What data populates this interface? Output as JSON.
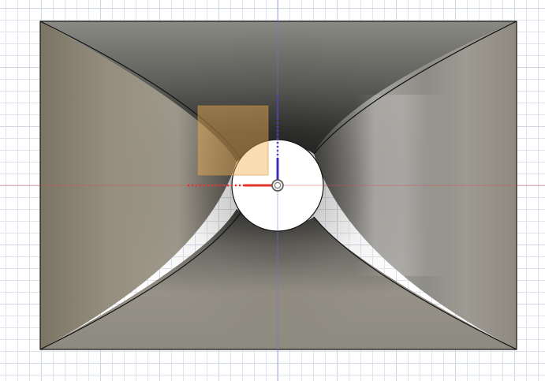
{
  "viewport": {
    "view": "top",
    "grid_visible": true,
    "background_color": "#ffffff",
    "grid_color": "#dfe5ec",
    "grid_major_color": "#cfd7e2"
  },
  "axes": {
    "x_axis_color": "#e34a4a",
    "y_axis_color": "#6f6fe0",
    "origin_marker": "origin-ring-icon"
  },
  "model": {
    "shape": "rectangular horn with circular throat",
    "body_color": "#8d8a80",
    "edge_color": "#111111",
    "throat_color": "#ffffff"
  },
  "sketch_plane": {
    "color": "#f2b255",
    "opacity": 0.45
  }
}
